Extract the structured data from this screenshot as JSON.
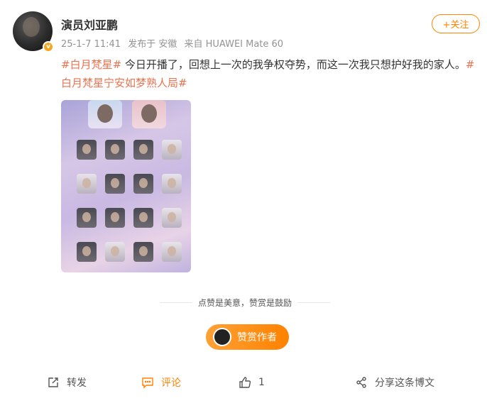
{
  "post": {
    "author": "演员刘亚鹏",
    "date": "25-1-7 11:41",
    "location": "发布于 安徽",
    "device": "来自 HUAWEI Mate 60",
    "follow_label": "+关注",
    "verified_badge": "v",
    "tag1": "#白月梵星#",
    "text": " 今日开播了，回想上一次的我争权夺势，而这一次我只想护好我的家人。",
    "tag2": "#白月梵星宁安如梦熟人局#"
  },
  "reward": {
    "hint": "点赞是美意，赞赏是鼓励",
    "button_label": "赞赏作者"
  },
  "actions": {
    "repost_label": "转发",
    "comment_label": "评论",
    "like_count": "1",
    "share_label": "分享这条博文"
  },
  "colors": {
    "accent": "#ff8200",
    "tag": "#eb7350"
  }
}
